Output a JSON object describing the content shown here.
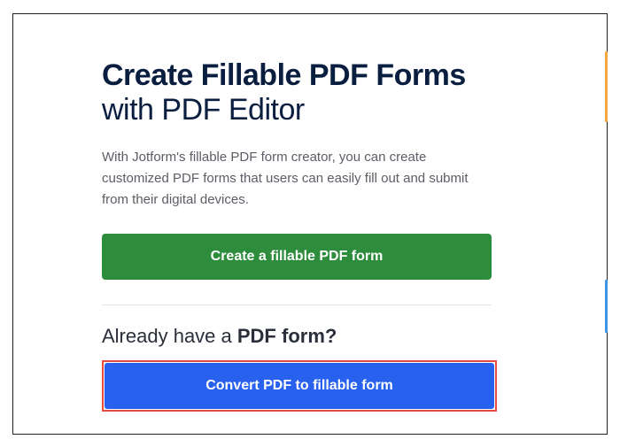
{
  "heading": {
    "bold": "Create Fillable PDF Forms",
    "light": "with PDF Editor"
  },
  "description": "With Jotform's fillable PDF form creator, you can create customized PDF forms that users can easily fill out and submit from their digital devices.",
  "buttons": {
    "create": "Create a fillable PDF form",
    "convert": "Convert PDF to fillable form"
  },
  "subheading": {
    "prefix": "Already have a ",
    "bold": "PDF form?"
  }
}
